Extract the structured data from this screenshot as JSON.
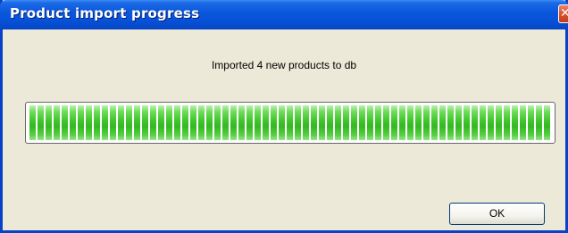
{
  "window": {
    "title": "Product import progress"
  },
  "titlebar": {
    "close_glyph": "✕",
    "close_icon": "close-icon"
  },
  "message": "Imported 4 new products to db",
  "progress": {
    "value": 1.0,
    "fill_color": "#3fc42a"
  },
  "buttons": {
    "ok_label": "OK"
  }
}
